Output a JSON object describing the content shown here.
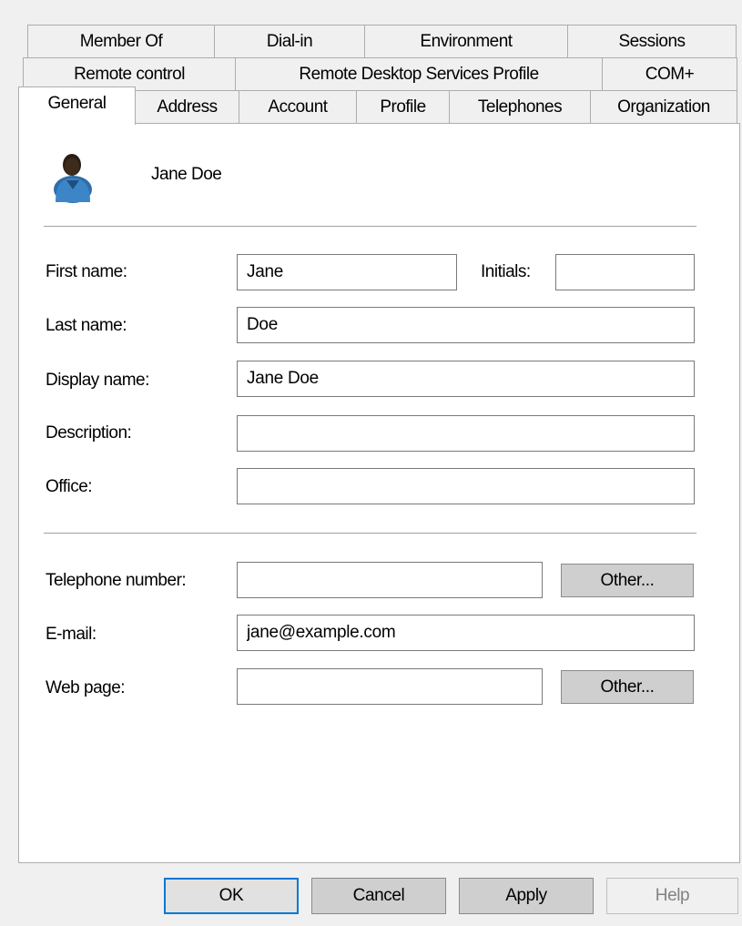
{
  "tabs": {
    "row1": [
      {
        "label": "Member Of"
      },
      {
        "label": "Dial-in"
      },
      {
        "label": "Environment"
      },
      {
        "label": "Sessions"
      }
    ],
    "row2": [
      {
        "label": "Remote control"
      },
      {
        "label": "Remote Desktop Services Profile"
      },
      {
        "label": "COM+"
      }
    ],
    "row3": [
      {
        "label": "General"
      },
      {
        "label": "Address"
      },
      {
        "label": "Account"
      },
      {
        "label": "Profile"
      },
      {
        "label": "Telephones"
      },
      {
        "label": "Organization"
      }
    ],
    "active": "General"
  },
  "general": {
    "user_icon": "user-avatar-icon",
    "display_header": "Jane Doe",
    "fields": {
      "first_name": {
        "label": "First name:",
        "value": "Jane"
      },
      "initials": {
        "label": "Initials:",
        "value": ""
      },
      "last_name": {
        "label": "Last name:",
        "value": "Doe"
      },
      "display_name": {
        "label": "Display name:",
        "value": "Jane Doe"
      },
      "description": {
        "label": "Description:",
        "value": ""
      },
      "office": {
        "label": "Office:",
        "value": ""
      },
      "telephone": {
        "label": "Telephone number:",
        "value": ""
      },
      "email": {
        "label": "E-mail:",
        "value": "jane@example.com"
      },
      "web_page": {
        "label": "Web page:",
        "value": ""
      }
    },
    "other_label": "Other..."
  },
  "footer": {
    "ok": "OK",
    "cancel": "Cancel",
    "apply": "Apply",
    "help": "Help"
  },
  "colors": {
    "dialog_bg": "#f0f0f0",
    "panel_bg": "#ffffff",
    "default_button_border": "#0078d7"
  }
}
